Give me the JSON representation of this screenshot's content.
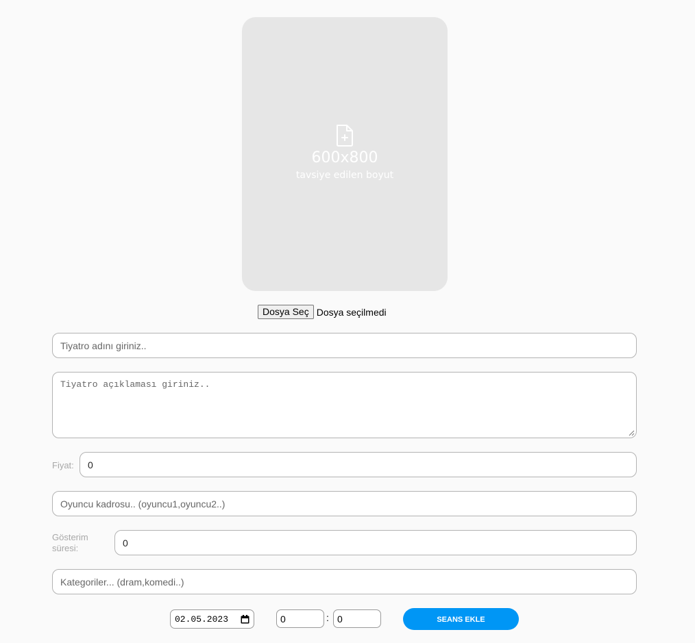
{
  "poster": {
    "size_text": "600x800",
    "hint_text": "tavsiye edilen boyut",
    "icon": "file-plus-icon"
  },
  "file_input": {
    "button_label": "Dosya Seç",
    "status_text": "Dosya seçilmedi"
  },
  "form": {
    "name_placeholder": "Tiyatro adını giriniz..",
    "description_placeholder": "Tiyatro açıklaması giriniz..",
    "price_label": "Fiyat:",
    "price_value": "0",
    "cast_placeholder": "Oyuncu kadrosu.. (oyuncu1,oyuncu2..)",
    "duration_label": "Gösterim süresi:",
    "duration_value": "0",
    "categories_placeholder": "Kategoriler... (dram,komedi..)"
  },
  "session": {
    "date_value": "02.05.2023",
    "hour_value": "0",
    "separator": ":",
    "minute_value": "0",
    "add_button_label": "SEANS EKLE"
  },
  "colors": {
    "accent": "#0096f5",
    "background": "#fafafa",
    "poster_bg": "#e6e6e6"
  }
}
